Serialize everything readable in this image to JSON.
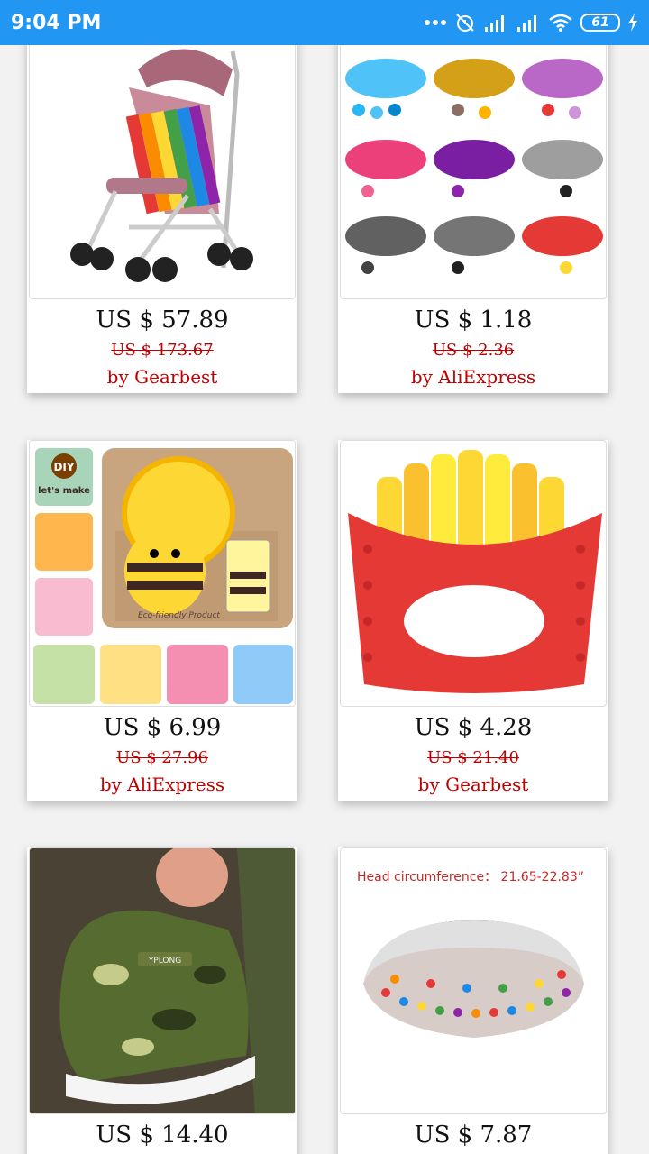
{
  "status_bar": {
    "time": "9:04 PM",
    "battery": "61",
    "icons": [
      "more-dots-icon",
      "alarm-off-icon",
      "signal-icon",
      "signal-icon",
      "wifi-icon",
      "battery-icon",
      "charging-icon"
    ]
  },
  "products": [
    {
      "price": "US $ 57.89",
      "old_price": "US $ 173.67",
      "vendor": "by Gearbest",
      "image": "stroller-image"
    },
    {
      "price": "US $ 1.18",
      "old_price": "US $ 2.36",
      "vendor": "by AliExpress",
      "image": "silicone-beads-image"
    },
    {
      "price": "US $ 6.99",
      "old_price": "US $ 27.96",
      "vendor": "by AliExpress",
      "image": "kids-tableware-set-image",
      "image_text": {
        "badge": "DIY",
        "sub": "let's make",
        "eco": "Eco-friendly Product"
      }
    },
    {
      "price": "US $ 4.28",
      "old_price": "US $ 21.40",
      "vendor": "by Gearbest",
      "image": "fries-teether-image"
    },
    {
      "price": "US $ 14.40",
      "old_price": "",
      "vendor": "",
      "image": "camo-sneakers-image",
      "image_text": {
        "brand": "YPLONG"
      }
    },
    {
      "price": "US $ 7.87",
      "old_price": "",
      "vendor": "",
      "image": "beaded-headband-image",
      "image_text": {
        "caption": "Head circumference： 21.65-22.83”"
      }
    }
  ],
  "colors": {
    "status_bar": "#2196f3",
    "price": "#111111",
    "vendor": "#c00000",
    "background": "#f2f2f2"
  }
}
